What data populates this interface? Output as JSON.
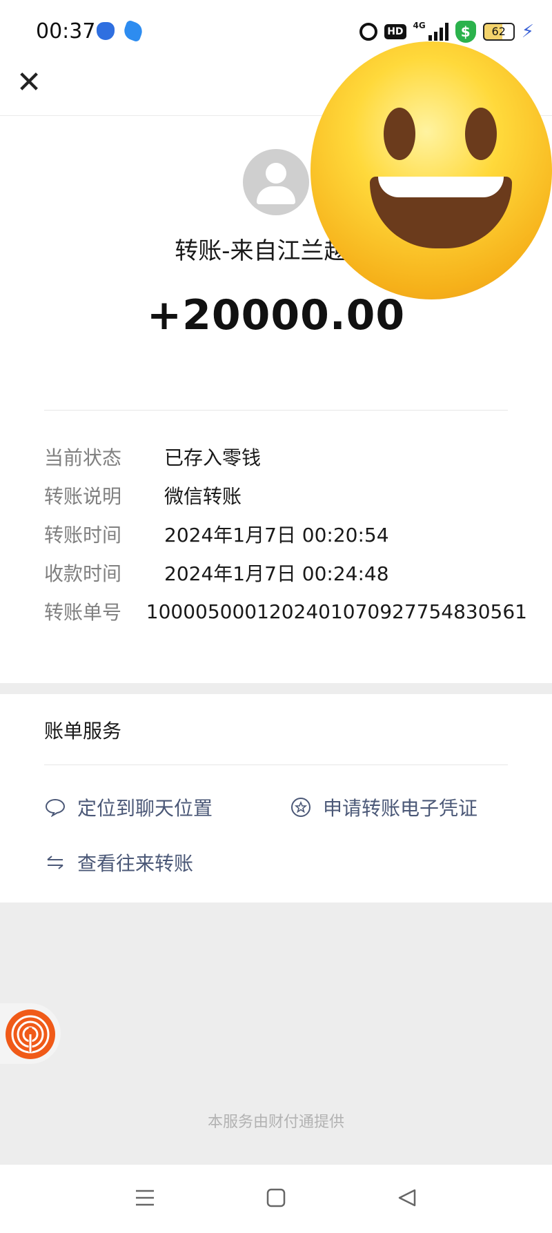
{
  "status_bar": {
    "time": "00:37",
    "hd": "HD",
    "network": "4G",
    "shield_symbol": "$",
    "battery": "62",
    "icons": [
      "baidu-icon",
      "browser-icon",
      "alarm-icon",
      "hd-icon",
      "signal-icon",
      "security-shield-icon",
      "battery-icon",
      "charging-icon"
    ]
  },
  "top_bar": {
    "close_icon": "close-icon"
  },
  "transfer": {
    "sender": "转账-来自江兰越22",
    "amount": "+20000.00",
    "details": [
      {
        "label": "当前状态",
        "value": "已存入零钱"
      },
      {
        "label": "转账说明",
        "value": "微信转账"
      },
      {
        "label": "转账时间",
        "value": "2024年1月7日 00:20:54"
      },
      {
        "label": "收款时间",
        "value": "2024年1月7日 00:24:48"
      },
      {
        "label": "转账单号",
        "value": "1000050001202401070927754830561"
      }
    ]
  },
  "services": {
    "title": "账单服务",
    "items": [
      {
        "label": "定位到聊天位置",
        "icon": "chat-bubble-icon"
      },
      {
        "label": "申请转账电子凭证",
        "icon": "star-badge-icon"
      },
      {
        "label": "查看往来转账",
        "icon": "swap-arrows-icon"
      }
    ]
  },
  "footer": {
    "note": "本服务由财付通提供"
  },
  "nav_bar": {
    "icons": [
      "menu-icon",
      "home-square-icon",
      "back-triangle-icon"
    ]
  },
  "colors": {
    "link": "#4b5877",
    "label_gray": "#808080",
    "page_bg": "#ededed",
    "float_orange": "#f05a18",
    "emoji_yellow": "#ffd93b"
  }
}
